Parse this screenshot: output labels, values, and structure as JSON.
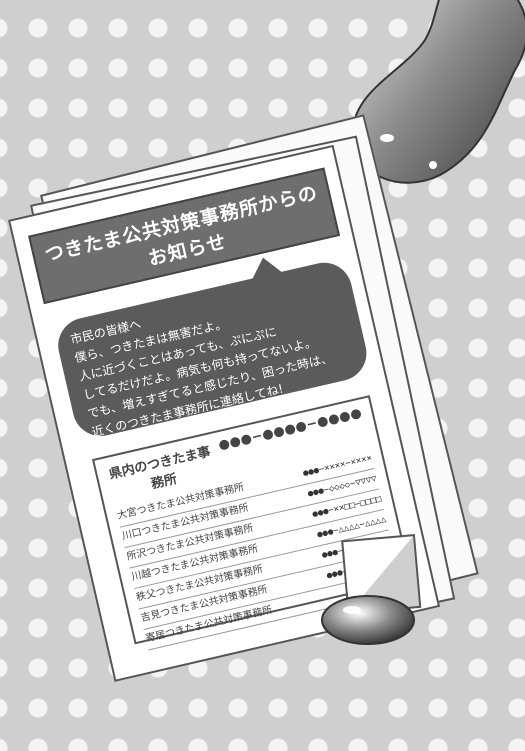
{
  "notice": {
    "title_line1": "つきたま公共対策事務所からの",
    "title_line2": "お知らせ",
    "message_lines": [
      "市民の皆様へ",
      "僕ら、つきたまは無害だよ。",
      "人に近づくことはあっても、ぷにぷに",
      "してるだけだよ。病気も何も持ってないよ。",
      "でも、増えすぎてると感じたり、困った時は、",
      "近くのつきたま事務所に連絡してね!"
    ]
  },
  "directory": {
    "heading_label": "県内のつきたま事務所",
    "heading_code": "●●●−●●●●−●●●●",
    "offices": [
      {
        "name": "大宮つきたま公共対策事務所",
        "code": "●●●−××××−××××"
      },
      {
        "name": "川口つきたま公共対策事務所",
        "code": "●●●−◇◇◇◇−▽▽▽▽"
      },
      {
        "name": "所沢つきたま公共対策事務所",
        "code": "●●●−××□□−□□□□"
      },
      {
        "name": "川越つきたま公共対策事務所",
        "code": "●●●−△△△△−△△△△"
      },
      {
        "name": "秩父つきたま公共対策事務所",
        "code": "●●●−▲▲□□−▼▼◇◇"
      },
      {
        "name": "吉見つきたま公共対策事務所",
        "code": "●●●−△△××−□□▽▽"
      },
      {
        "name": "寄居つきたま公共対策事務所",
        "code": ""
      }
    ]
  },
  "colors": {
    "background": "#cfcfcf",
    "dots": "#f4f4f4",
    "title_bar": "#6e6e6e",
    "bubble": "#5b5b5b"
  }
}
